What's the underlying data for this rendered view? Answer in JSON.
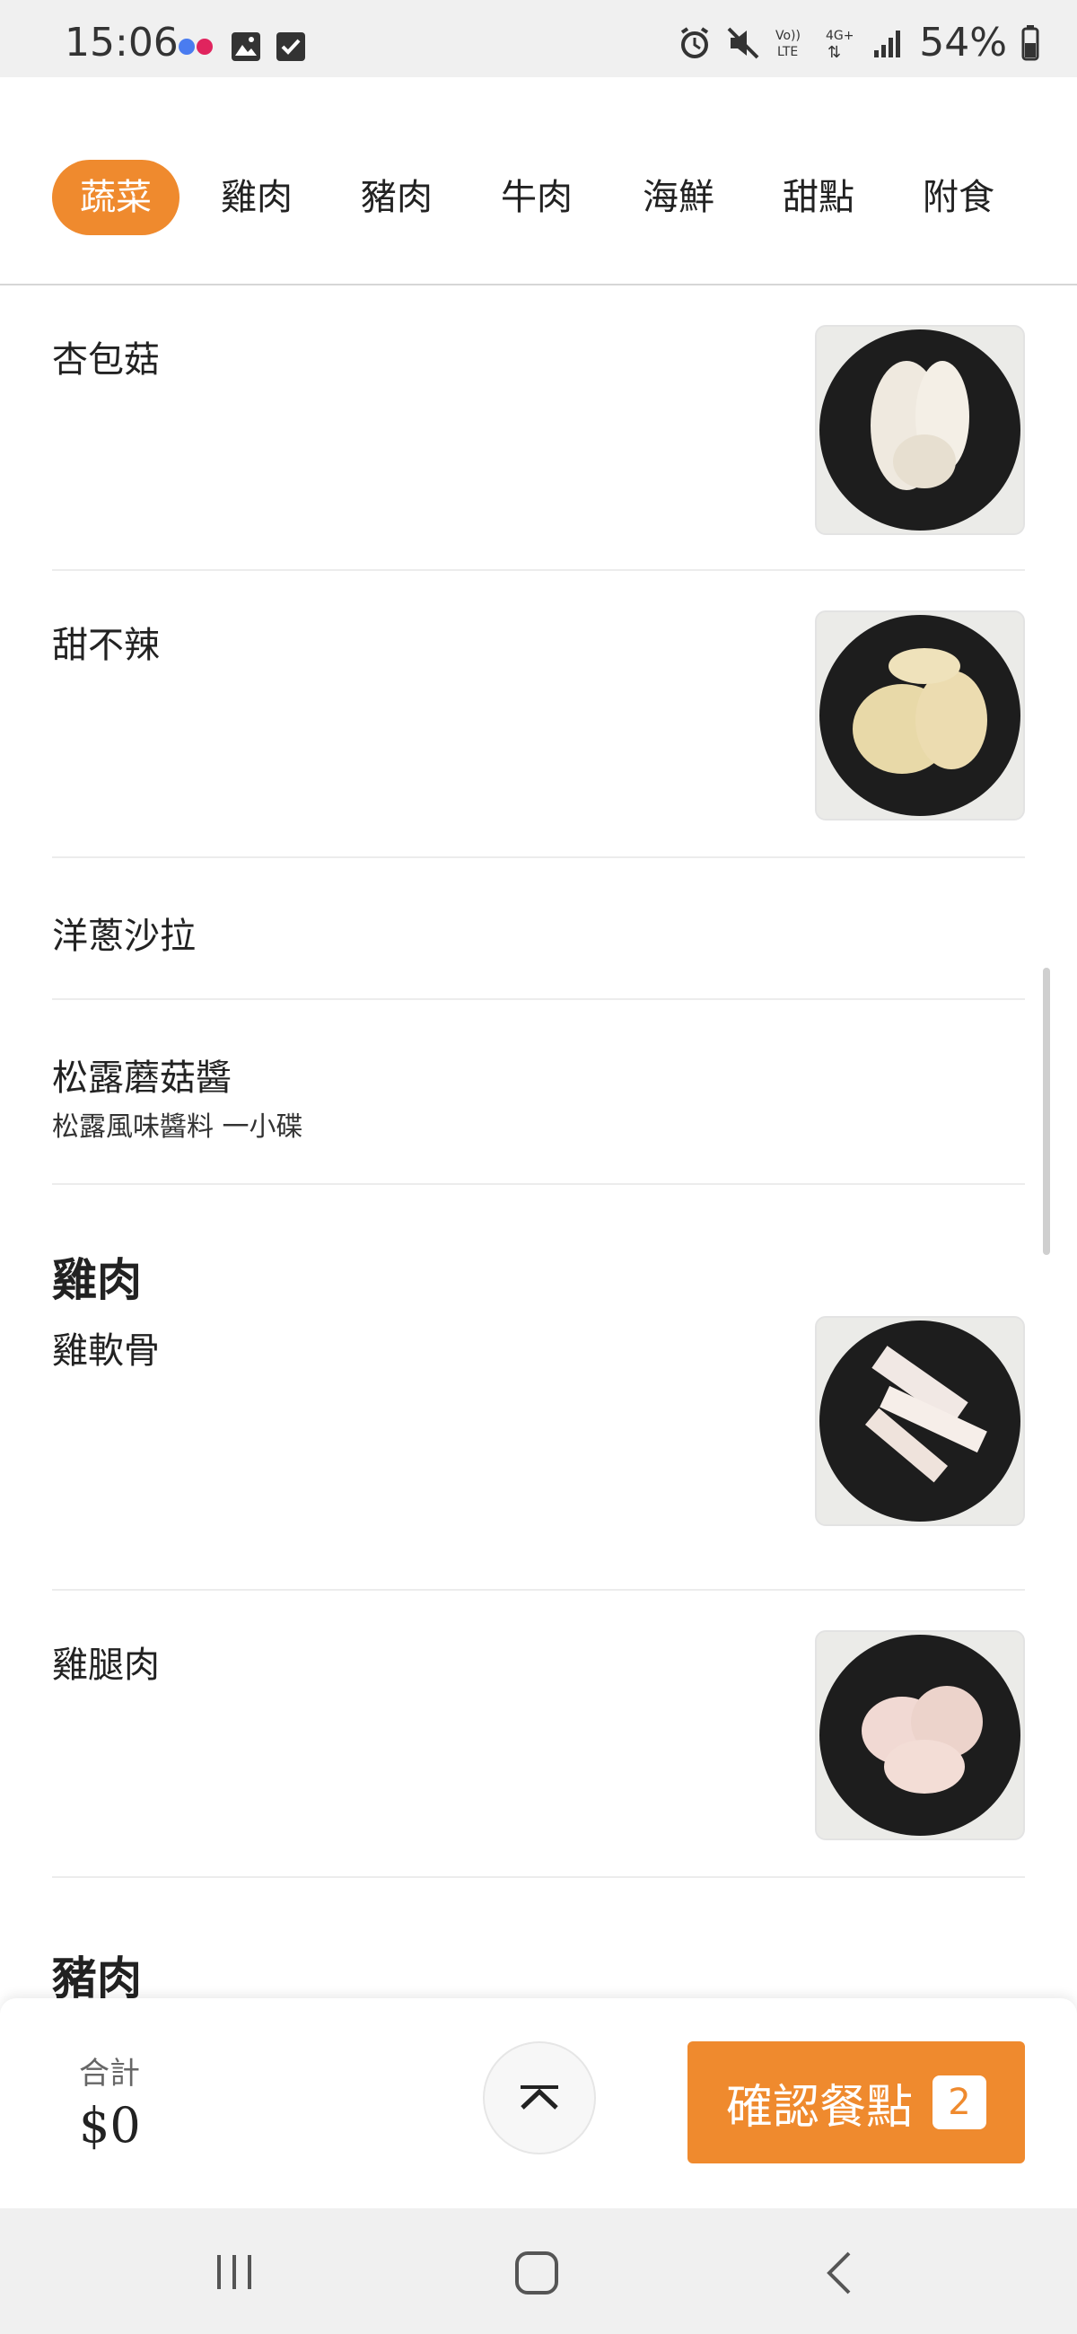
{
  "status_bar": {
    "time": "15:06",
    "battery": "54%",
    "network_labels": [
      "Vo)) LTE",
      "4G+"
    ]
  },
  "tabs": [
    {
      "label": "蔬菜",
      "active": true
    },
    {
      "label": "雞肉",
      "active": false
    },
    {
      "label": "豬肉",
      "active": false
    },
    {
      "label": "牛肉",
      "active": false
    },
    {
      "label": "海鮮",
      "active": false
    },
    {
      "label": "甜點",
      "active": false
    },
    {
      "label": "附食",
      "active": false
    }
  ],
  "menu": {
    "vegetables": [
      {
        "name": "杏包菇",
        "has_image": true
      },
      {
        "name": "甜不辣",
        "has_image": true
      },
      {
        "name": "洋蔥沙拉",
        "has_image": false
      },
      {
        "name": "松露蘑菇醬",
        "desc": "松露風味醬料 一小碟",
        "has_image": false
      }
    ],
    "chicken_section_title": "雞肉",
    "chicken": [
      {
        "name": "雞軟骨",
        "has_image": true
      },
      {
        "name": "雞腿肉",
        "has_image": true
      }
    ],
    "pork_section_title": "豬肉"
  },
  "footer": {
    "total_label": "合計",
    "total_value": "$0",
    "confirm_label": "確認餐點",
    "cart_count": "2"
  },
  "colors": {
    "accent": "#ef8a2e"
  }
}
